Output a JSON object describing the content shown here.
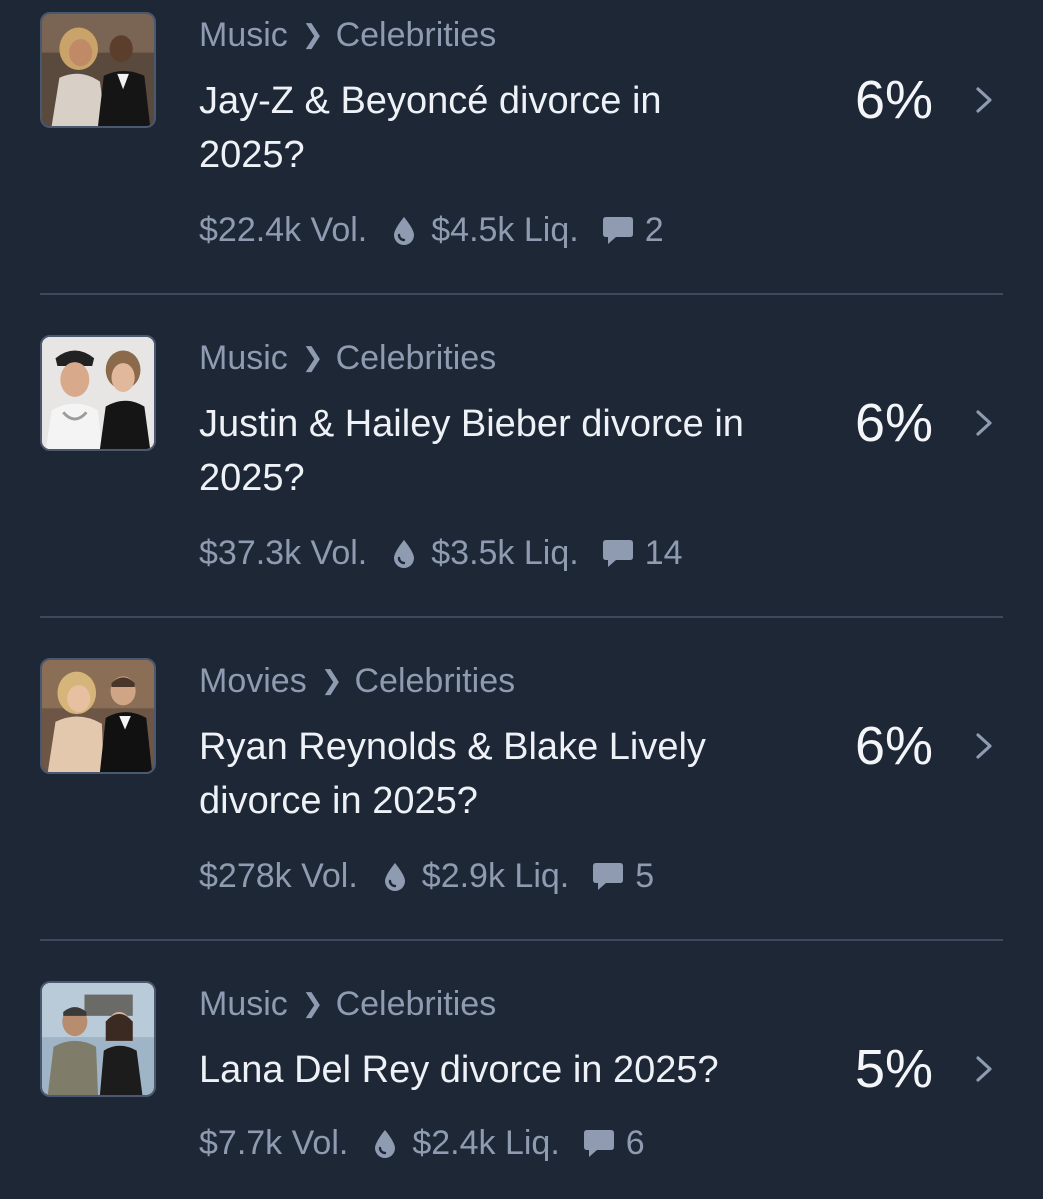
{
  "markets": [
    {
      "category": "Music",
      "subcategory": "Celebrities",
      "title": "Jay-Z & Beyoncé divorce in 2025?",
      "probability": "6%",
      "volume": "$22.4k Vol.",
      "liquidity": "$4.5k Liq.",
      "comments": "2",
      "thumbnail": "couple-photo-jayz-beyonce"
    },
    {
      "category": "Music",
      "subcategory": "Celebrities",
      "title": "Justin & Hailey Bieber divorce in 2025?",
      "probability": "6%",
      "volume": "$37.3k Vol.",
      "liquidity": "$3.5k Liq.",
      "comments": "14",
      "thumbnail": "couple-photo-justin-hailey"
    },
    {
      "category": "Movies",
      "subcategory": "Celebrities",
      "title": "Ryan Reynolds & Blake Lively divorce in 2025?",
      "probability": "6%",
      "volume": "$278k Vol.",
      "liquidity": "$2.9k Liq.",
      "comments": "5",
      "thumbnail": "couple-photo-ryan-blake"
    },
    {
      "category": "Music",
      "subcategory": "Celebrities",
      "title": "Lana Del Rey divorce in 2025?",
      "probability": "5%",
      "volume": "$7.7k Vol.",
      "liquidity": "$2.4k Liq.",
      "comments": "6",
      "thumbnail": "couple-photo-lana"
    }
  ],
  "colors": {
    "background": "#1d2736",
    "primary_text": "#eef1f6",
    "muted_text": "#8e9bb0",
    "divider": "#3d4a5e"
  },
  "icons": {
    "breadcrumb_separator": "chevron-right-icon",
    "liquidity": "droplet-icon",
    "comments": "comment-bubble-icon",
    "open": "chevron-right-icon"
  }
}
